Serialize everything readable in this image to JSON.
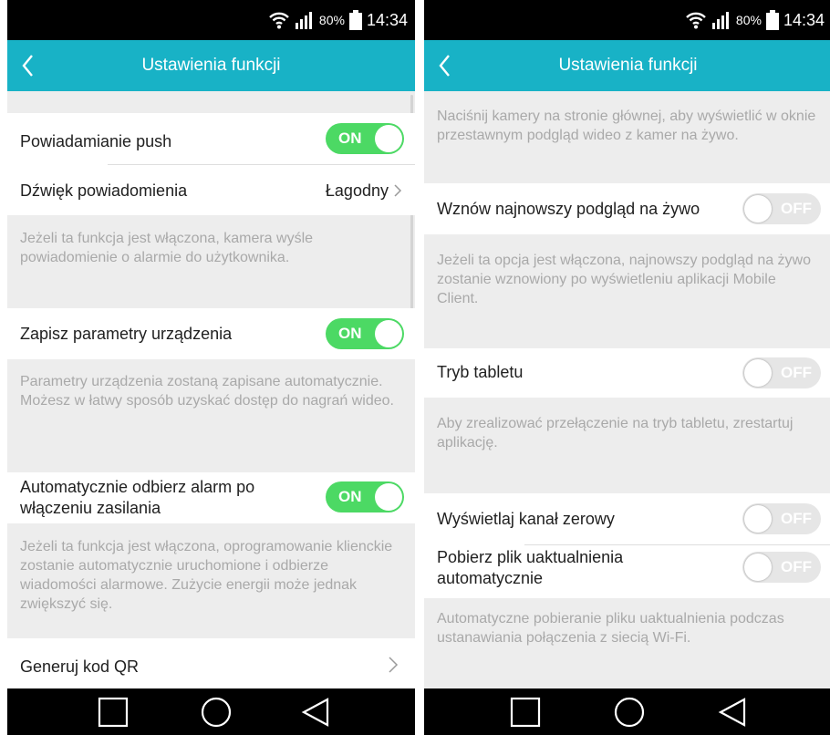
{
  "left": {
    "status": {
      "battery": "80%",
      "time": "14:34"
    },
    "header": {
      "title": "Ustawienia funkcji"
    },
    "push": {
      "label": "Powiadamianie push",
      "toggle": "ON"
    },
    "sound": {
      "label": "Dźwięk powiadomienia",
      "value": "Łagodny"
    },
    "push_desc": "Jeżeli ta funkcja jest włączona, kamera wyśle powiadomienie o alarmie do użytkownika.",
    "save": {
      "label": "Zapisz parametry urządzenia",
      "toggle": "ON"
    },
    "save_desc": "Parametry urządzenia zostaną zapisane automatycznie. Możesz w łatwy sposób uzyskać dostęp do nagrań wideo.",
    "auto_alarm": {
      "label_line1": "Automatycznie odbierz alarm po",
      "label_line2": "włączeniu zasilania",
      "toggle": "ON"
    },
    "auto_alarm_desc": "Jeżeli ta funkcja jest włączona, oprogramowanie klienckie zostanie automatycznie uruchomione i odbierze wiadomości alarmowe. Zużycie energii może jednak zwiększyć się.",
    "qr": {
      "label": "Generuj kod QR"
    }
  },
  "right": {
    "status": {
      "battery": "80%",
      "time": "14:34"
    },
    "header": {
      "title": "Ustawienia funkcji"
    },
    "top_desc": "Naciśnij kamery na stronie głównej, aby wyświetlić w oknie przestawnym podgląd wideo z kamer na żywo.",
    "resume": {
      "label": "Wznów najnowszy podgląd na żywo",
      "toggle": "OFF"
    },
    "resume_desc": "Jeżeli ta opcja jest włączona, najnowszy podgląd na żywo zostanie wznowiony po wyświetleniu aplikacji Mobile Client.",
    "tablet": {
      "label": "Tryb tabletu",
      "toggle": "OFF"
    },
    "tablet_desc": "Aby zrealizować przełączenie na tryb tabletu, zrestartuj aplikację.",
    "zero_channel": {
      "label": "Wyświetlaj kanał zerowy",
      "toggle": "OFF"
    },
    "auto_update": {
      "label_line1": "Pobierz plik uaktualnienia",
      "label_line2": "automatycznie",
      "toggle": "OFF"
    },
    "auto_update_desc": "Automatyczne pobieranie pliku uaktualnienia podczas ustanawiania połączenia z siecią Wi-Fi."
  },
  "icons": [
    "wifi-icon",
    "signal-icon",
    "battery-icon",
    "back-arrow-icon",
    "chevron-right-icon",
    "recent-apps-icon",
    "home-icon",
    "back-triangle-icon"
  ],
  "colors": {
    "header": "#18b2c6",
    "toggle_on": "#4cd964",
    "toggle_off": "#e6e6e6",
    "background": "#ededed"
  }
}
